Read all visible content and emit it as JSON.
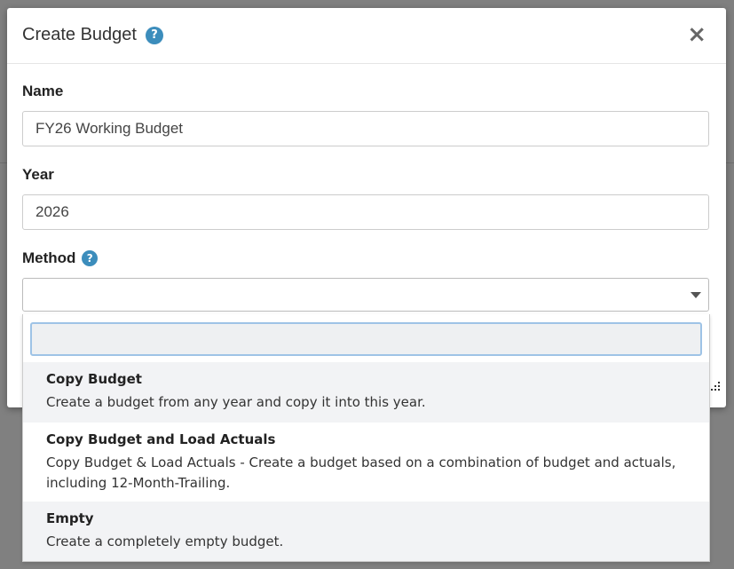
{
  "modal": {
    "title": "Create Budget",
    "help_symbol": "?",
    "close_symbol": "×"
  },
  "fields": {
    "name_label": "Name",
    "name_value": "FY26 Working Budget",
    "year_label": "Year",
    "year_value": "2026",
    "method_label": "Method",
    "method_value": ""
  },
  "dropdown": {
    "search_value": "",
    "options": [
      {
        "title": "Copy Budget",
        "description": "Create a budget from any year and copy it into this year."
      },
      {
        "title": "Copy Budget and Load Actuals",
        "description": "Copy Budget & Load Actuals - Create a budget based on a combination of budget and actuals, including 12-Month-Trailing."
      },
      {
        "title": "Empty",
        "description": "Create a completely empty budget."
      }
    ]
  },
  "colors": {
    "help_badge": "#3c8dbc",
    "search_focus_border": "#9ec3e6"
  },
  "icons": {
    "help": "question-circle-icon",
    "close": "close-icon",
    "caret": "caret-down-icon",
    "resize": "resize-grip-icon"
  }
}
